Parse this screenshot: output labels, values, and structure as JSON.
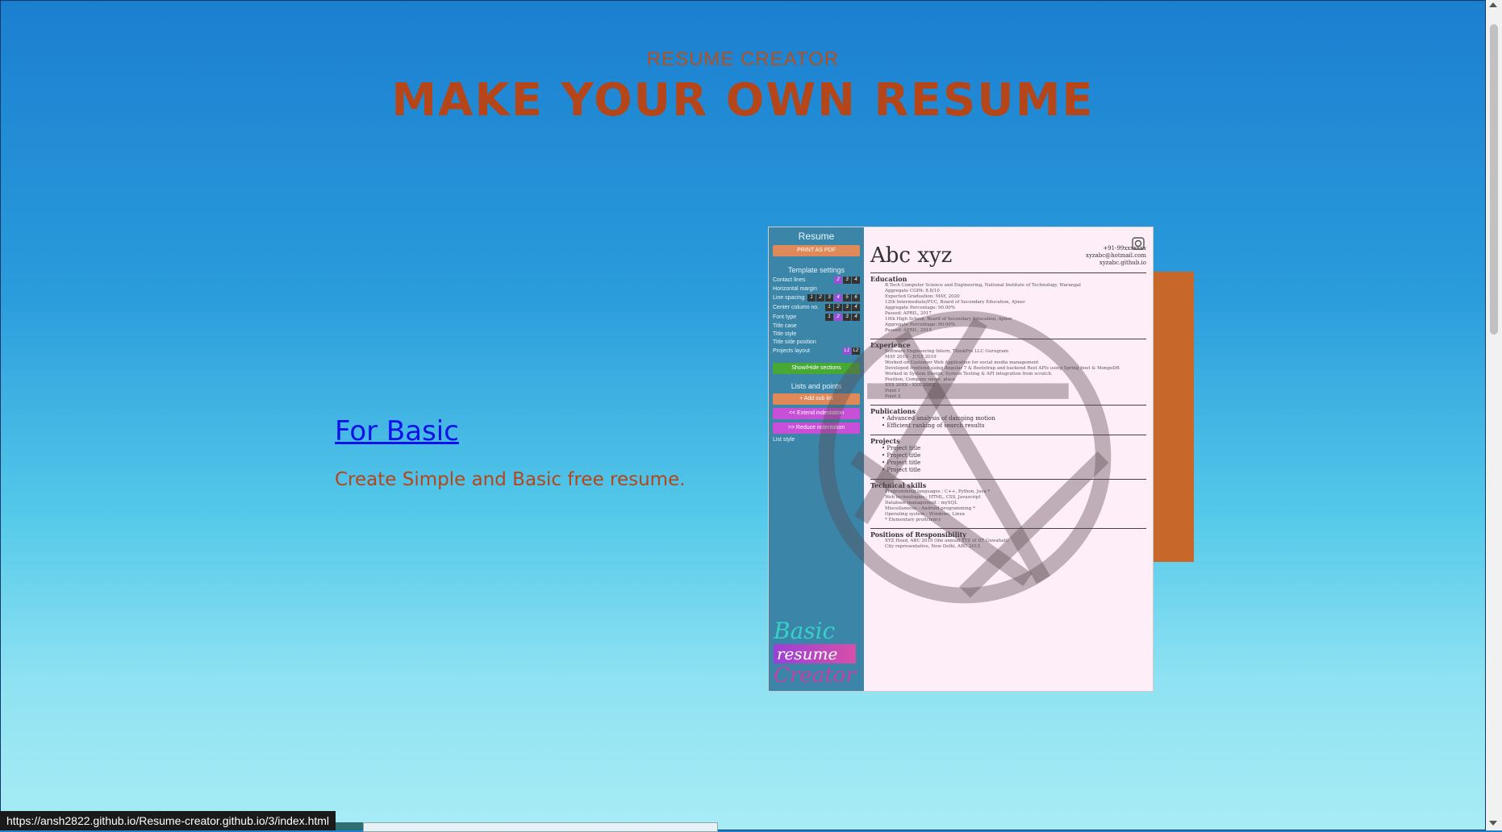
{
  "header": {
    "kicker": "RESUME CREATOR",
    "headline": "MAKE YOUR OWN RESUME"
  },
  "basic": {
    "link_label": "For Basic",
    "description": "Create Simple and Basic free resume."
  },
  "preview": {
    "sidebar_title": "Resume",
    "print_label": "PRINT AS PDF",
    "template_settings": "Template settings",
    "settings": [
      "Contact lines",
      "Horizontal margin",
      "Line spacing",
      "Center column no.",
      "Font type",
      "Title case",
      "Title style",
      "Title side position",
      "Projects layout"
    ],
    "show_hide": "Show/Hide sections",
    "lists_points": "Lists and points",
    "list_buttons": [
      "+ Add sub list",
      "<< Extend indentation",
      ">> Reduce indentation"
    ],
    "list_style": "List style",
    "logo_lines": [
      "Basic",
      "resume",
      "Creator"
    ],
    "name": "Abc xyz",
    "contact": [
      "+91-99xxxxxxx",
      "xyzabc@hotmail.com",
      "xyzabc.github.io"
    ],
    "sections": [
      {
        "title": "Education",
        "lines": [
          "B.Tech Computer Science and Engineering, National Institute of Technology, Warangal",
          "Aggregate CGPA: 8.8/10",
          "Expected Graduation: MAY, 2020",
          "12th Intermediate/PUC, Board of Secondary Education, Ajmer",
          "Aggregate Percentage: 90.00%",
          "Passed: APRIL, 2017",
          "10th High School, Board of Secondary Education, Ajmer",
          "Aggregate Percentage: 90.00%",
          "Passed: APRIL, 2015"
        ]
      },
      {
        "title": "Experience",
        "lines": [
          "Software Engineering Intern, ThinkPro LLC Gurugram",
          "MAY 2019 - JULY 2019",
          "Worked on Customer Web Application for social media management",
          "Developed frontend using Angular 7 & Bootstrap and backend Rest APIs using Spring boot & MongoDB",
          "Worked in System Design, System Testing & API integration from scratch.",
          "Position, Company name, place",
          "XXX 20XX - XXX 20XX",
          "Point 1",
          "Point 2"
        ]
      },
      {
        "title": "Publications",
        "lines": [
          "Advanced analysis of damping motion",
          "Efficient ranking of search results"
        ]
      },
      {
        "title": "Projects",
        "lines": [
          "Project title",
          "Project title",
          "Project title",
          "Project title"
        ]
      },
      {
        "title": "Technical skills",
        "lines": [
          "Programming languages : C++, Python, Java *",
          "Web technologies : HTML, CSS, Javascript",
          "Database management : mySQL",
          "Miscellaneous : Android programming *",
          "Operating system : Windows, Linux",
          "* Elementary proficiency"
        ]
      },
      {
        "title": "Positions of Responsibility",
        "lines": [
          "XYZ Head, ABC 2019 (the annual XYZ of IIT Guwahati)",
          "City representative, New Delhi, ABC 2015"
        ]
      }
    ]
  },
  "status_url": "https://ansh2822.github.io/Resume-creator.github.io/3/index.html",
  "colors": {
    "accent": "#b4461a",
    "link": "#1010e8",
    "orange_block": "#c8672a"
  }
}
